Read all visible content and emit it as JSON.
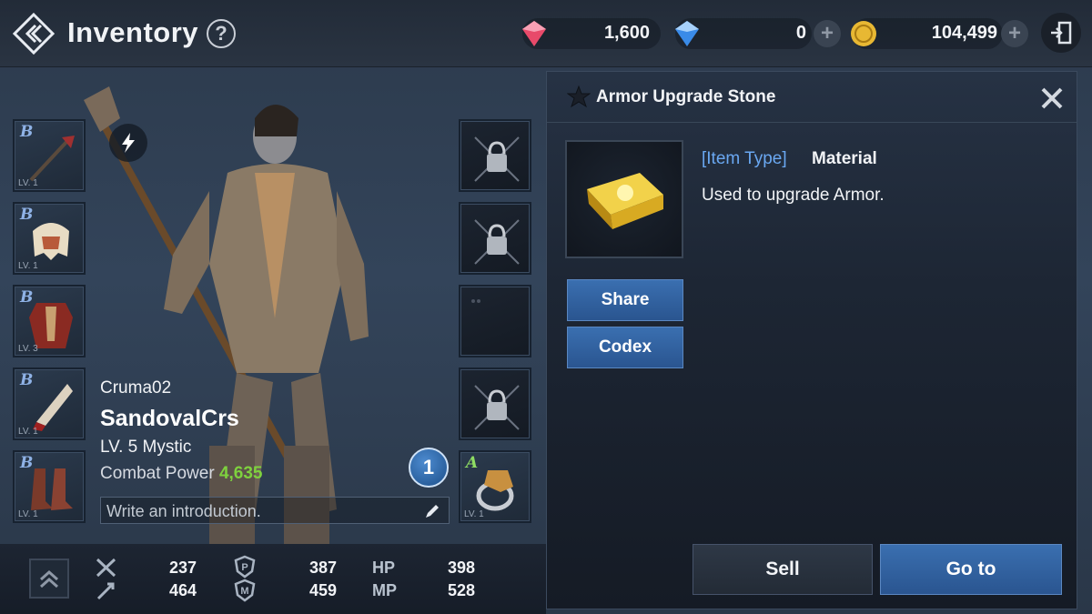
{
  "header": {
    "title": "Inventory",
    "help_icon": "?",
    "currencies": [
      {
        "name": "red-diamond",
        "value": "1,600",
        "color": "#e84a6a"
      },
      {
        "name": "blue-diamond",
        "value": "0",
        "color": "#3a8be8"
      },
      {
        "name": "adena-gold",
        "value": "104,499",
        "color": "#e8b833"
      }
    ],
    "plus_label": "+"
  },
  "equipment_left": [
    {
      "grade": "B",
      "level": "LV. 1",
      "item": "staff"
    },
    {
      "grade": "B",
      "level": "LV. 1",
      "item": "helmet"
    },
    {
      "grade": "B",
      "level": "LV. 3",
      "item": "armor"
    },
    {
      "grade": "B",
      "level": "LV. 1",
      "item": "gloves"
    },
    {
      "grade": "B",
      "level": "LV. 1",
      "item": "boots"
    }
  ],
  "equipment_right": [
    {
      "state": "locked",
      "item": "necklace-slot"
    },
    {
      "state": "locked",
      "item": "earring-slot"
    },
    {
      "state": "empty",
      "item": "earring-slot"
    },
    {
      "state": "locked",
      "item": "ring-slot"
    },
    {
      "grade": "A",
      "level": "LV. 1",
      "item": "ring"
    }
  ],
  "character": {
    "server": "Cruma02",
    "name": "SandovalCrs",
    "class_line": "LV. 5  Mystic",
    "combat_power_label": "Combat Power",
    "combat_power_value": "4,635",
    "intro_placeholder": "Write an introduction.",
    "notification_count": "1"
  },
  "stats": {
    "melee_attack": "237",
    "ranged_attack": "464",
    "physical_defense": "387",
    "magic_defense": "459",
    "hp_label": "HP",
    "hp_value": "398",
    "mp_label": "MP",
    "mp_value": "528"
  },
  "item_panel": {
    "title": "Armor Upgrade Stone",
    "item_type_label": "[Item Type]",
    "item_type_value": "Material",
    "description": "Used to upgrade Armor.",
    "share_label": "Share",
    "codex_label": "Codex",
    "sell_label": "Sell",
    "goto_label": "Go to"
  }
}
